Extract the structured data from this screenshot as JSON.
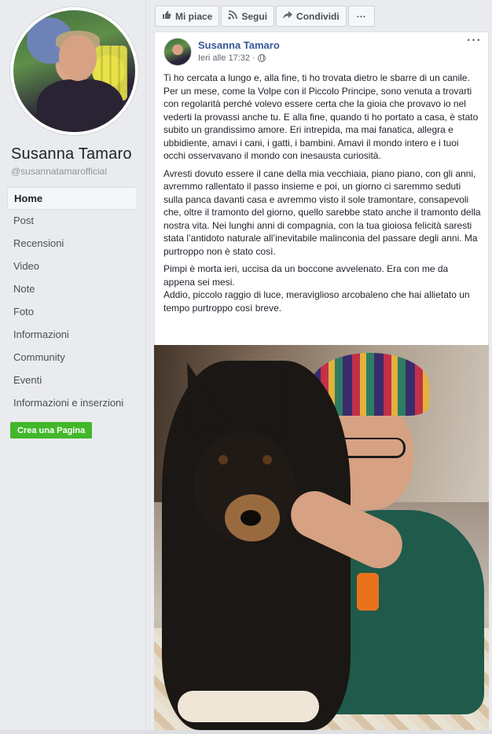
{
  "sidebar": {
    "page_name": "Susanna Tamaro",
    "page_handle": "@susannatamarofficial",
    "nav": [
      {
        "label": "Home",
        "active": true
      },
      {
        "label": "Post"
      },
      {
        "label": "Recensioni"
      },
      {
        "label": "Video"
      },
      {
        "label": "Note"
      },
      {
        "label": "Foto"
      },
      {
        "label": "Informazioni"
      },
      {
        "label": "Community"
      },
      {
        "label": "Eventi"
      },
      {
        "label": "Informazioni e inserzioni"
      }
    ],
    "create_page_label": "Crea una Pagina"
  },
  "actions": {
    "like": {
      "label": "Mi piace",
      "icon": "thumbs-up-icon"
    },
    "follow": {
      "label": "Segui",
      "icon": "rss-icon"
    },
    "share": {
      "label": "Condividi",
      "icon": "share-arrow-icon"
    },
    "more": {
      "label": "···",
      "icon": "more-dots-icon"
    }
  },
  "post": {
    "author": "Susanna Tamaro",
    "timestamp": "Ieri alle 17:32",
    "separator": "·",
    "privacy_icon": "globe-icon",
    "options": "···",
    "paragraphs": [
      "Ti ho cercata a lungo e, alla fine, ti ho trovata dietro le sbarre di un canile. Per un mese, come la Volpe con il Piccolo Principe, sono venuta a trovarti con regolarità perché volevo essere certa che la gioia che provavo io nel vederti la provassi anche tu. E alla fine, quando ti ho portato a casa, è stato subito un grandissimo amore. Eri intrepida, ma mai fanatica, allegra e ubbidiente, amavi i cani, i gatti, i bambini. Amavi il mondo intero e i tuoi occhi osservavano il mondo con inesausta curiosità.",
      "Avresti dovuto essere il cane della mia vecchiaia, piano piano, con gli anni, avremmo rallentato il passo insieme e poi, un giorno ci saremmo seduti sulla panca davanti casa e avremmo visto il sole tramontare, consapevoli che, oltre il tramonto del giorno, quello sarebbe stato anche il tramonto della nostra vita. Nei lunghi anni di compagnia, con la tua gioiosa felicità saresti stata l’antidoto naturale all’inevitabile malinconia del passare degli anni. Ma purtroppo non è stato così.",
      "Pimpi è morta ieri, uccisa da un boccone avvelenato. Era con me da appena sei mesi.",
      "Addio, piccolo raggio di luce, meraviglioso arcobaleno che hai allietato un tempo purtroppo così breve."
    ]
  },
  "colors": {
    "link": "#365899",
    "create_button": "#42b72a",
    "background": "#e9ebee"
  }
}
